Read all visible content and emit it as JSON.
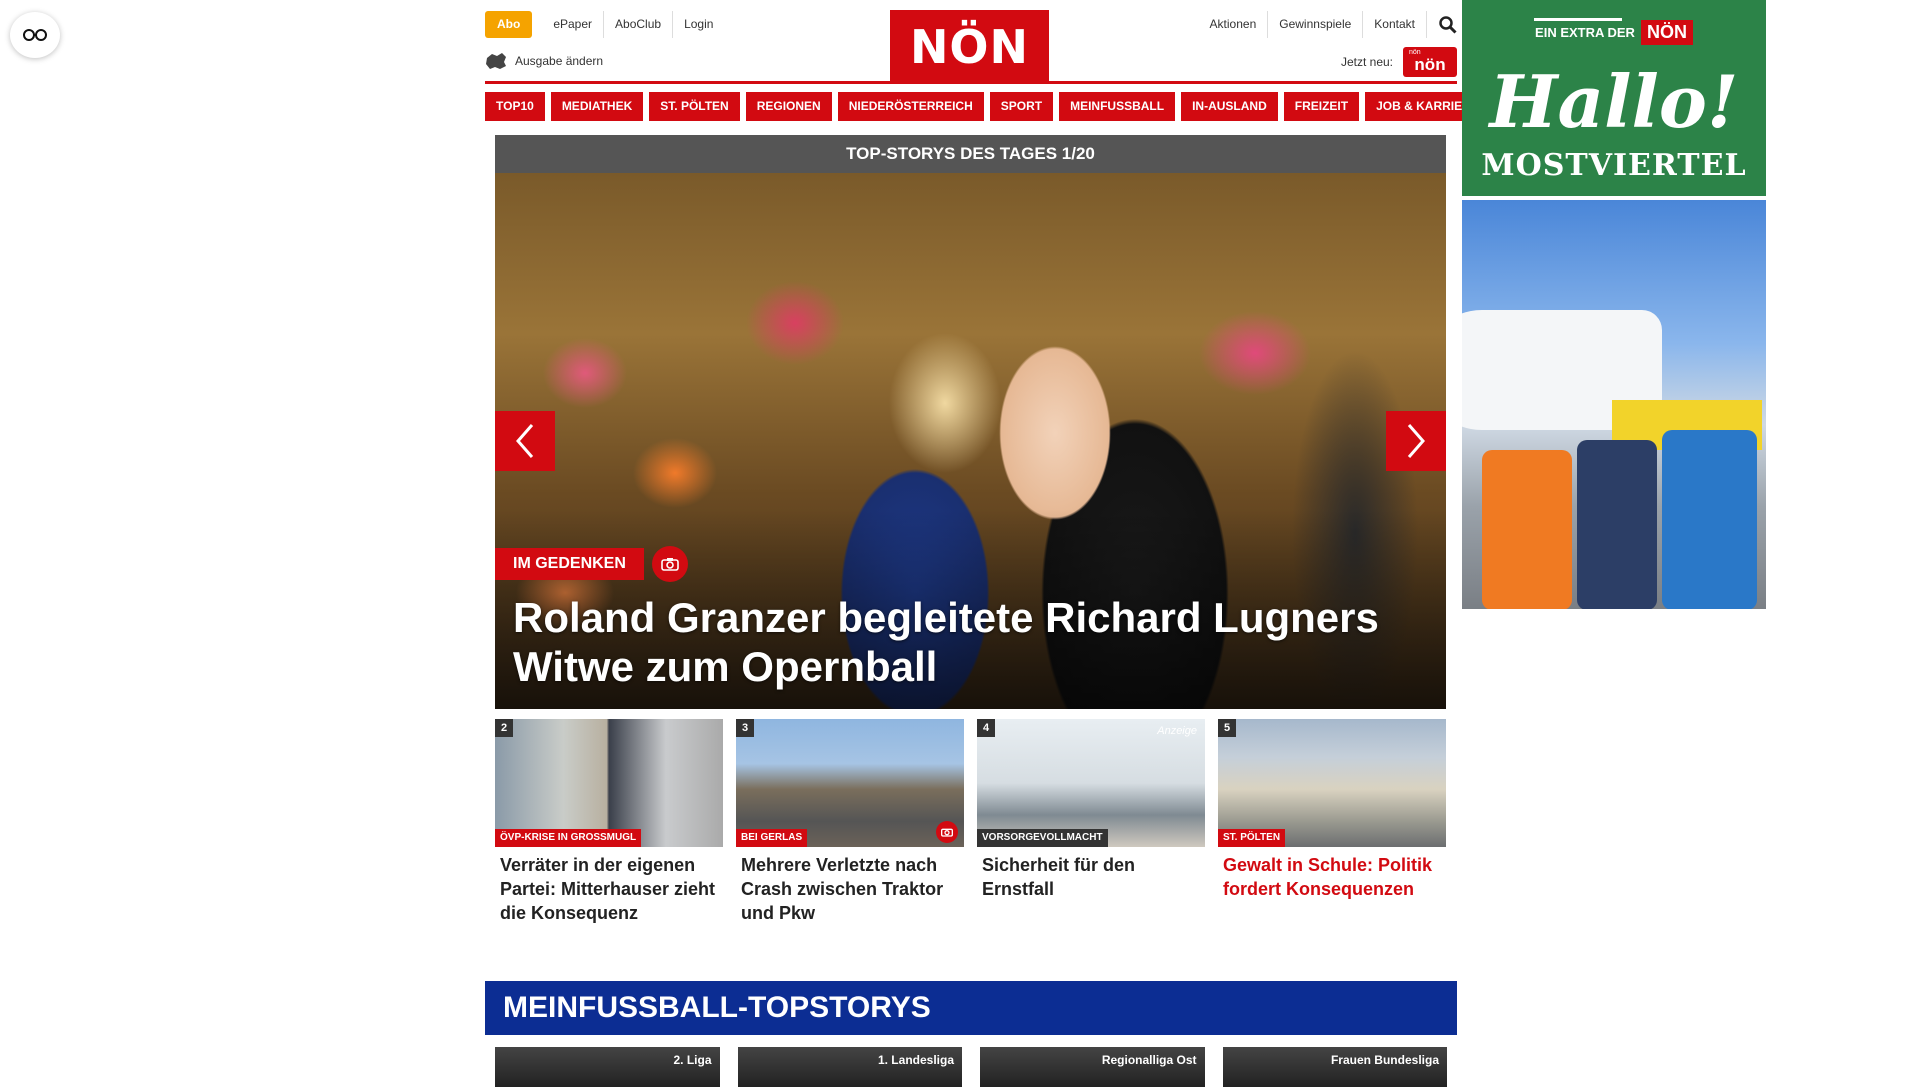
{
  "topbar": {
    "abo": "Abo",
    "left_links": [
      "ePaper",
      "AboClub",
      "Login"
    ],
    "ausgabe": "Ausgabe ändern",
    "logo": "NÖN",
    "right_links": [
      "Aktionen",
      "Gewinnspiele",
      "Kontakt"
    ],
    "jetzt_neu": "Jetzt neu:",
    "mini_logo_small": "nön",
    "mini_logo": "nön"
  },
  "nav": [
    "TOP10",
    "MEDIATHEK",
    "ST. PÖLTEN",
    "REGIONEN",
    "NIEDERÖSTERREICH",
    "SPORT",
    "MEINFUSSBALL",
    "IN-AUSLAND",
    "FREIZEIT",
    "JOB & KARRIERE"
  ],
  "topstories": {
    "header": "TOP-STORYS DES TAGES 1/20",
    "hero": {
      "category": "IM GEDENKEN",
      "title": "Roland Granzer begleitete Richard Lugners Witwe zum Opernball"
    },
    "teasers": [
      {
        "num": "2",
        "category": "ÖVP-KRISE IN GROSSMUGL",
        "title": "Verräter in der eigenen Partei: Mitterhauser zieht die Konsequenz"
      },
      {
        "num": "3",
        "category": "BEI GERLAS",
        "title": "Mehrere Verletzte nach Crash zwischen Traktor und Pkw"
      },
      {
        "num": "4",
        "category": "VORSORGEVOLLMACHT",
        "title": "Sicherheit für den Ernstfall",
        "badge": "Anzeige"
      },
      {
        "num": "5",
        "category": "ST. PÖLTEN",
        "title": "Gewalt in Schule: Politik fordert Konsequenzen"
      }
    ]
  },
  "meinfussball": {
    "header": "MEINFUSSBALL-TOPSTORYS",
    "cards": [
      "2. Liga",
      "1. Landesliga",
      "Regionalliga Ost",
      "Frauen Bundesliga"
    ]
  },
  "ad": {
    "extra": "EIN EXTRA DER",
    "brand": "NÖN",
    "hallo": "Hallo!",
    "region": "MOSTVIERTEL"
  },
  "colors": {
    "brand_red": "#d20a11",
    "abo_orange": "#f5a300",
    "mf_blue": "#0c2d93",
    "ad_green": "#2c8348"
  }
}
